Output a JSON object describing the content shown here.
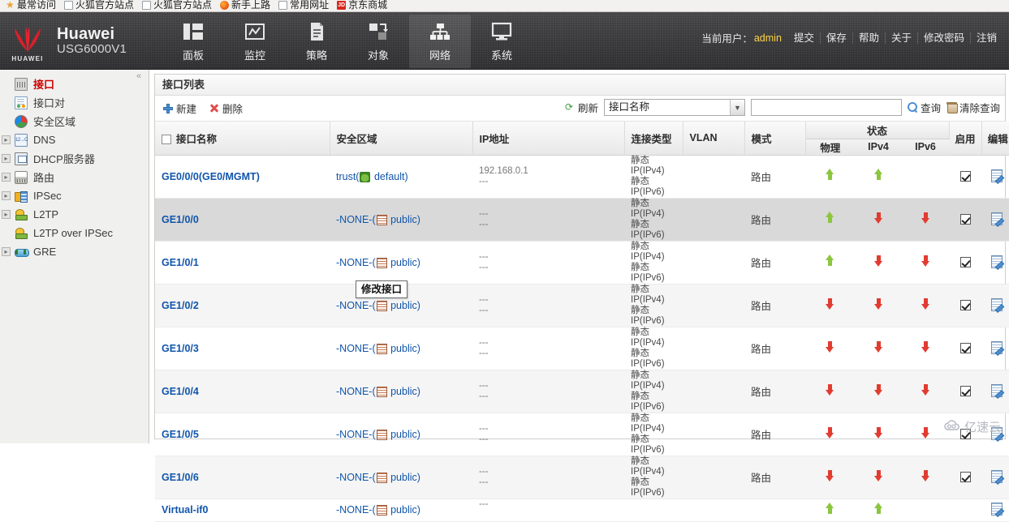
{
  "browser": {
    "bookmarks": [
      {
        "label": "最常访问",
        "icon": "star-icon"
      },
      {
        "label": "火狐官方站点",
        "icon": "page-icon"
      },
      {
        "label": "火狐官方站点",
        "icon": "page-icon"
      },
      {
        "label": "新手上路",
        "icon": "firefox-icon"
      },
      {
        "label": "常用网址",
        "icon": "page-icon"
      },
      {
        "label": "京东商城",
        "icon": "jd-icon"
      }
    ]
  },
  "header": {
    "brand_name": "Huawei",
    "brand_model": "USG6000V1",
    "logo_word": "HUAWEI",
    "nav": [
      {
        "label": "面板",
        "icon": "dashboard-icon",
        "active": false
      },
      {
        "label": "监控",
        "icon": "monitor-icon",
        "active": false
      },
      {
        "label": "策略",
        "icon": "policy-icon",
        "active": false
      },
      {
        "label": "对象",
        "icon": "object-icon",
        "active": false
      },
      {
        "label": "网络",
        "icon": "network-icon",
        "active": true
      },
      {
        "label": "系统",
        "icon": "system-icon",
        "active": false
      }
    ],
    "user_label": "当前用户：",
    "user_name": "admin",
    "actions": [
      "提交",
      "保存",
      "帮助",
      "关于",
      "修改密码",
      "注销"
    ]
  },
  "sidebar": {
    "collapse_icon": "«",
    "items": [
      {
        "label": "接口",
        "icon": "interface-icon",
        "expandable": false,
        "selected": true
      },
      {
        "label": "接口对",
        "icon": "interface-pair-icon",
        "expandable": false,
        "selected": false
      },
      {
        "label": "安全区域",
        "icon": "security-zone-icon",
        "expandable": false,
        "selected": false
      },
      {
        "label": "DNS",
        "icon": "dns-icon",
        "expandable": true,
        "selected": false
      },
      {
        "label": "DHCP服务器",
        "icon": "dhcp-icon",
        "expandable": true,
        "selected": false
      },
      {
        "label": "路由",
        "icon": "route-icon",
        "expandable": true,
        "selected": false
      },
      {
        "label": "IPSec",
        "icon": "ipsec-icon",
        "expandable": true,
        "selected": false
      },
      {
        "label": "L2TP",
        "icon": "l2tp-icon",
        "expandable": true,
        "selected": false
      },
      {
        "label": "L2TP over IPSec",
        "icon": "l2tp-over-ipsec-icon",
        "expandable": false,
        "selected": false
      },
      {
        "label": "GRE",
        "icon": "gre-icon",
        "expandable": true,
        "selected": false
      }
    ]
  },
  "panel": {
    "title": "接口列表",
    "toolbar": {
      "new_label": "新建",
      "delete_label": "删除",
      "refresh_label": "刷新",
      "filter_selected": "接口名称",
      "filter_options": [
        "接口名称"
      ],
      "search_value": "",
      "search_placeholder": "",
      "query_label": "查询",
      "clear_query_label": "清除查询"
    },
    "table": {
      "headers": {
        "name": "接口名称",
        "zone": "安全区域",
        "ip": "IP地址",
        "conn_type": "连接类型",
        "vlan": "VLAN",
        "mode": "模式",
        "status": "状态",
        "status_phys": "物理",
        "status_ipv4": "IPv4",
        "status_ipv6": "IPv6",
        "enable": "启用",
        "edit": "编辑"
      },
      "rows": [
        {
          "name": "GE0/0/0(GE0/MGMT)",
          "zone_prefix": "trust(",
          "zone_icon": "zone-icon",
          "zone_name": "default",
          "zone_suffix": ")",
          "ip_v4": "192.168.0.1",
          "ip_v6": "---",
          "conn_v4": "静态IP(IPv4)",
          "conn_v6": "静态IP(IPv6)",
          "vlan": "",
          "mode": "路由",
          "st_phys": "up",
          "st_ipv4": "up",
          "st_ipv6": "",
          "enabled": true,
          "editable": true,
          "shade": "plain"
        },
        {
          "name": "GE1/0/0",
          "zone_prefix": "-NONE-(",
          "zone_icon": "vrf-icon",
          "zone_name": "public",
          "zone_suffix": ")",
          "ip_v4": "---",
          "ip_v6": "---",
          "conn_v4": "静态IP(IPv4)",
          "conn_v6": "静态IP(IPv6)",
          "vlan": "",
          "mode": "路由",
          "st_phys": "up",
          "st_ipv4": "down",
          "st_ipv6": "down",
          "enabled": true,
          "editable": true,
          "shade": "hl"
        },
        {
          "name": "GE1/0/1",
          "zone_prefix": "-NONE-(",
          "zone_icon": "vrf-icon",
          "zone_name": "public",
          "zone_suffix": ")",
          "ip_v4": "---",
          "ip_v6": "---",
          "conn_v4": "静态IP(IPv4)",
          "conn_v6": "静态IP(IPv6)",
          "vlan": "",
          "mode": "路由",
          "st_phys": "up",
          "st_ipv4": "down",
          "st_ipv6": "down",
          "enabled": true,
          "editable": true,
          "shade": "plain"
        },
        {
          "name": "GE1/0/2",
          "zone_prefix": "-NONE-(",
          "zone_icon": "vrf-icon",
          "zone_name": "public",
          "zone_suffix": ")",
          "ip_v4": "---",
          "ip_v6": "---",
          "conn_v4": "静态IP(IPv4)",
          "conn_v6": "静态IP(IPv6)",
          "vlan": "",
          "mode": "路由",
          "st_phys": "down",
          "st_ipv4": "down",
          "st_ipv6": "down",
          "enabled": true,
          "editable": true,
          "shade": "alt"
        },
        {
          "name": "GE1/0/3",
          "zone_prefix": "-NONE-(",
          "zone_icon": "vrf-icon",
          "zone_name": "public",
          "zone_suffix": ")",
          "ip_v4": "---",
          "ip_v6": "---",
          "conn_v4": "静态IP(IPv4)",
          "conn_v6": "静态IP(IPv6)",
          "vlan": "",
          "mode": "路由",
          "st_phys": "down",
          "st_ipv4": "down",
          "st_ipv6": "down",
          "enabled": true,
          "editable": true,
          "shade": "plain"
        },
        {
          "name": "GE1/0/4",
          "zone_prefix": "-NONE-(",
          "zone_icon": "vrf-icon",
          "zone_name": "public",
          "zone_suffix": ")",
          "ip_v4": "---",
          "ip_v6": "---",
          "conn_v4": "静态IP(IPv4)",
          "conn_v6": "静态IP(IPv6)",
          "vlan": "",
          "mode": "路由",
          "st_phys": "down",
          "st_ipv4": "down",
          "st_ipv6": "down",
          "enabled": true,
          "editable": true,
          "shade": "alt"
        },
        {
          "name": "GE1/0/5",
          "zone_prefix": "-NONE-(",
          "zone_icon": "vrf-icon",
          "zone_name": "public",
          "zone_suffix": ")",
          "ip_v4": "---",
          "ip_v6": "---",
          "conn_v4": "静态IP(IPv4)",
          "conn_v6": "静态IP(IPv6)",
          "vlan": "",
          "mode": "路由",
          "st_phys": "down",
          "st_ipv4": "down",
          "st_ipv6": "down",
          "enabled": true,
          "editable": true,
          "shade": "plain"
        },
        {
          "name": "GE1/0/6",
          "zone_prefix": "-NONE-(",
          "zone_icon": "vrf-icon",
          "zone_name": "public",
          "zone_suffix": ")",
          "ip_v4": "---",
          "ip_v6": "---",
          "conn_v4": "静态IP(IPv4)",
          "conn_v6": "静态IP(IPv6)",
          "vlan": "",
          "mode": "路由",
          "st_phys": "down",
          "st_ipv4": "down",
          "st_ipv6": "down",
          "enabled": true,
          "editable": true,
          "shade": "alt"
        },
        {
          "name": "Virtual-if0",
          "zone_prefix": "-NONE-(",
          "zone_icon": "vrf-icon",
          "zone_name": "public",
          "zone_suffix": ")",
          "ip_v4": "---",
          "ip_v6": "",
          "conn_v4": "",
          "conn_v6": "",
          "vlan": "",
          "mode": "",
          "st_phys": "up",
          "st_ipv4": "up",
          "st_ipv6": "",
          "enabled": false,
          "editable": true,
          "shade": "plain"
        }
      ]
    }
  },
  "tooltip": {
    "text": "修改接口"
  },
  "watermark": {
    "text": "亿速云",
    "icon": "cloud-icon"
  },
  "colors": {
    "header_bg": "#3a3a3c",
    "link": "#1155aa",
    "selected_menu": "#cc0000",
    "status_up": "#8cc63f",
    "status_down": "#e23b30",
    "user_name": "#ffd54a"
  }
}
